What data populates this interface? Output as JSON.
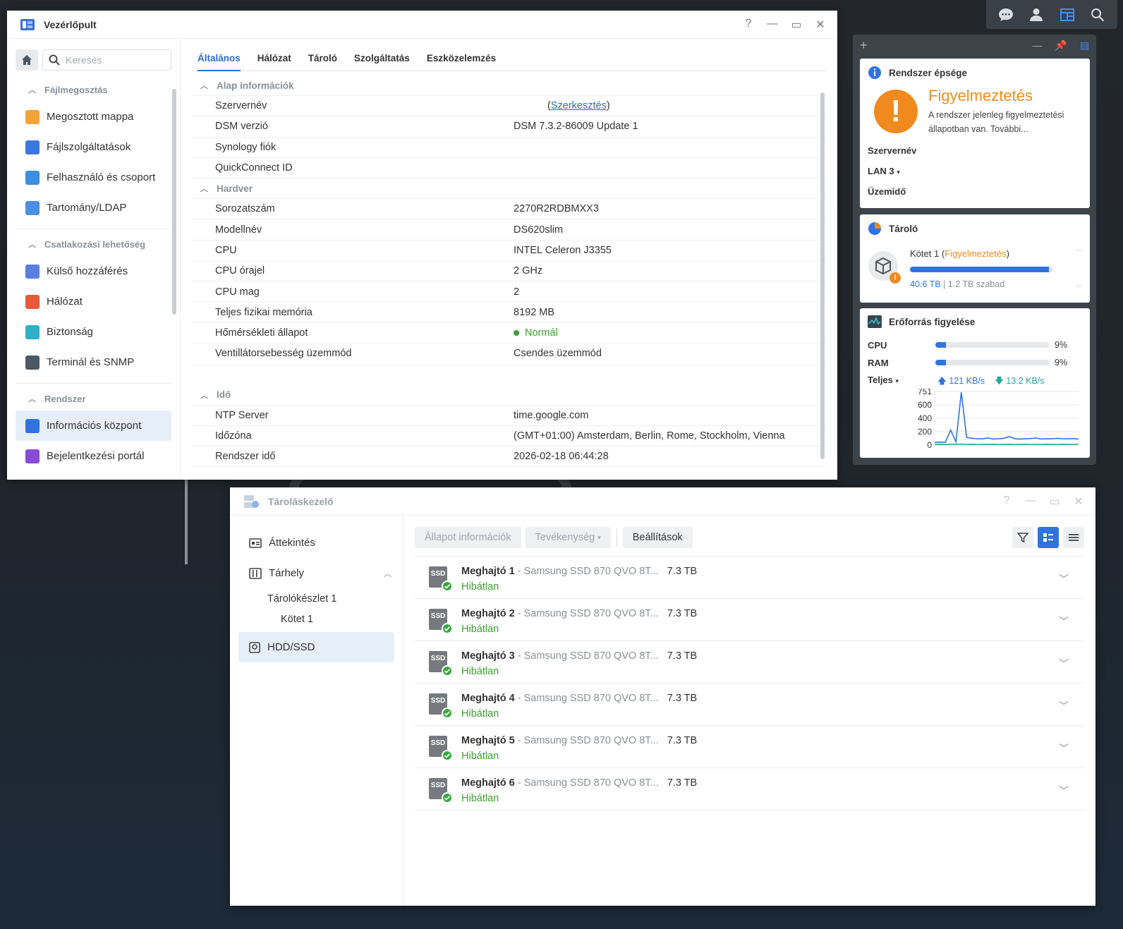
{
  "topbar": {
    "icons": [
      "chat-icon",
      "user-icon",
      "widgets-icon",
      "search-icon"
    ]
  },
  "control_panel": {
    "title": "Vezérlőpult",
    "controls": {
      "help": "?",
      "minimize": "—",
      "maximize": "▭",
      "close": "✕"
    },
    "search": {
      "placeholder": "Keresés"
    },
    "sidebar": {
      "sections": [
        {
          "label": "Fájlmegosztás",
          "items": [
            {
              "label": "Megosztott mappa",
              "color": "#f4a338"
            },
            {
              "label": "Fájlszolgáltatások",
              "color": "#3a78e0"
            },
            {
              "label": "Felhasználó és csoport",
              "color": "#3c8ee0"
            },
            {
              "label": "Tartomány/LDAP",
              "color": "#4a90e2"
            }
          ]
        },
        {
          "label": "Csatlakozási lehetőség",
          "items": [
            {
              "label": "Külső hozzáférés",
              "color": "#5a7fe0"
            },
            {
              "label": "Hálózat",
              "color": "#e65a3a"
            },
            {
              "label": "Biztonság",
              "color": "#30b0c8"
            },
            {
              "label": "Terminál és SNMP",
              "color": "#4b5866"
            }
          ]
        },
        {
          "label": "Rendszer",
          "items": [
            {
              "label": "Információs központ",
              "color": "#2f73e0",
              "active": true
            },
            {
              "label": "Bejelentkezési portál",
              "color": "#8a4ad8"
            }
          ]
        }
      ]
    },
    "tabs": [
      "Általános",
      "Hálózat",
      "Tároló",
      "Szolgáltatás",
      "Eszközelemzés"
    ],
    "groups": {
      "basic": {
        "label": "Alap információk",
        "rows": [
          {
            "k": "Szervernév",
            "v": "(Szerkesztés)"
          },
          {
            "k": "DSM verzió",
            "v": "DSM 7.3.2-86009 Update 1"
          },
          {
            "k": "Synology fiók",
            "v": ""
          },
          {
            "k": "QuickConnect ID",
            "v": ""
          }
        ]
      },
      "hardware": {
        "label": "Hardver",
        "rows": [
          {
            "k": "Sorozatszám",
            "v": "2270R2RDBMXX3"
          },
          {
            "k": "Modellnév",
            "v": "DS620slim"
          },
          {
            "k": "CPU",
            "v": "INTEL Celeron J3355"
          },
          {
            "k": "CPU órajel",
            "v": "2 GHz"
          },
          {
            "k": "CPU mag",
            "v": "2"
          },
          {
            "k": "Teljes fizikai memória",
            "v": "8192 MB"
          },
          {
            "k": "Hőmérsékleti állapot",
            "v": "Normál"
          },
          {
            "k": "Ventillátorsebesség üzemmód",
            "v": "Csendes üzemmód"
          }
        ]
      },
      "time": {
        "label": "Idő",
        "rows": [
          {
            "k": "NTP Server",
            "v": "time.google.com"
          },
          {
            "k": "Időzóna",
            "v": "(GMT+01:00) Amsterdam, Berlin, Rome, Stockholm, Vienna"
          },
          {
            "k": "Rendszer idő",
            "v": "2026-02-18 06:44:28"
          }
        ]
      }
    }
  },
  "widgets": {
    "top": {
      "add": "+",
      "minimize": "—"
    },
    "health": {
      "title": "Rendszer épsége",
      "status": "Figyelmeztetés",
      "desc": "A rendszer jelenleg figyelmeztetési állapotban van. További...",
      "server_label": "Szervernév",
      "lan_label": "LAN 3",
      "uptime_label": "Üzemidő"
    },
    "storage": {
      "title": "Tároló",
      "volume": "Kötet 1",
      "volume_status": "Figyelmeztetés",
      "used": "40.6 TB",
      "free": "1.2 TB szabad",
      "fill": 0.97
    },
    "monitor": {
      "title": "Erőforrás figyelése",
      "cpu_label": "CPU",
      "cpu_val": "9%",
      "cpu_fill": 0.09,
      "ram_label": "RAM",
      "ram_val": "9%",
      "ram_fill": 0.09,
      "net_label": "Teljes",
      "up": "121 KB/s",
      "down": "13.2 KB/s",
      "yticks": [
        "751",
        "600",
        "400",
        "200",
        "0"
      ],
      "upload_series": [
        40,
        42,
        38,
        210,
        45,
        740,
        110,
        95,
        90,
        88,
        100,
        85,
        90,
        95,
        120,
        90,
        85,
        88,
        92,
        100,
        85,
        90,
        88,
        95,
        90,
        88,
        92,
        85
      ],
      "download_series": [
        10,
        12,
        8,
        10,
        12,
        15,
        10,
        12,
        10,
        11,
        10,
        12,
        10,
        11,
        12,
        10,
        11,
        12,
        10,
        11,
        10,
        12,
        11,
        10,
        12,
        11,
        10,
        12
      ],
      "ymax": 751
    }
  },
  "storage_manager": {
    "title": "Tároláskezelő",
    "controls": {
      "help": "?",
      "minimize": "—",
      "maximize": "▭",
      "close": "✕"
    },
    "nav": {
      "overview": "Áttekintés",
      "storage": "Tárhely",
      "pool": "Tárolókészlet 1",
      "volume": "Kötet 1",
      "hdd": "HDD/SSD"
    },
    "toolbar": {
      "status": "Állapot információk",
      "action": "Tevékenység",
      "settings": "Beállítások"
    },
    "drives": [
      {
        "name": "Meghajtó 1",
        "model": " - Samsung SSD 870 QVO 8T...",
        "size": "7.3 TB",
        "status": "Hibátlan",
        "badge": "SSD"
      },
      {
        "name": "Meghajtó 2",
        "model": " - Samsung SSD 870 QVO 8T...",
        "size": "7.3 TB",
        "status": "Hibátlan",
        "badge": "SSD"
      },
      {
        "name": "Meghajtó 3",
        "model": " - Samsung SSD 870 QVO 8T...",
        "size": "7.3 TB",
        "status": "Hibátlan",
        "badge": "SSD"
      },
      {
        "name": "Meghajtó 4",
        "model": " - Samsung SSD 870 QVO 8T...",
        "size": "7.3 TB",
        "status": "Hibátlan",
        "badge": "SSD"
      },
      {
        "name": "Meghajtó 5",
        "model": " - Samsung SSD 870 QVO 8T...",
        "size": "7.3 TB",
        "status": "Hibátlan",
        "badge": "SSD"
      },
      {
        "name": "Meghajtó 6",
        "model": " - Samsung SSD 870 QVO 8T...",
        "size": "7.3 TB",
        "status": "Hibátlan",
        "badge": "SSD"
      }
    ]
  }
}
